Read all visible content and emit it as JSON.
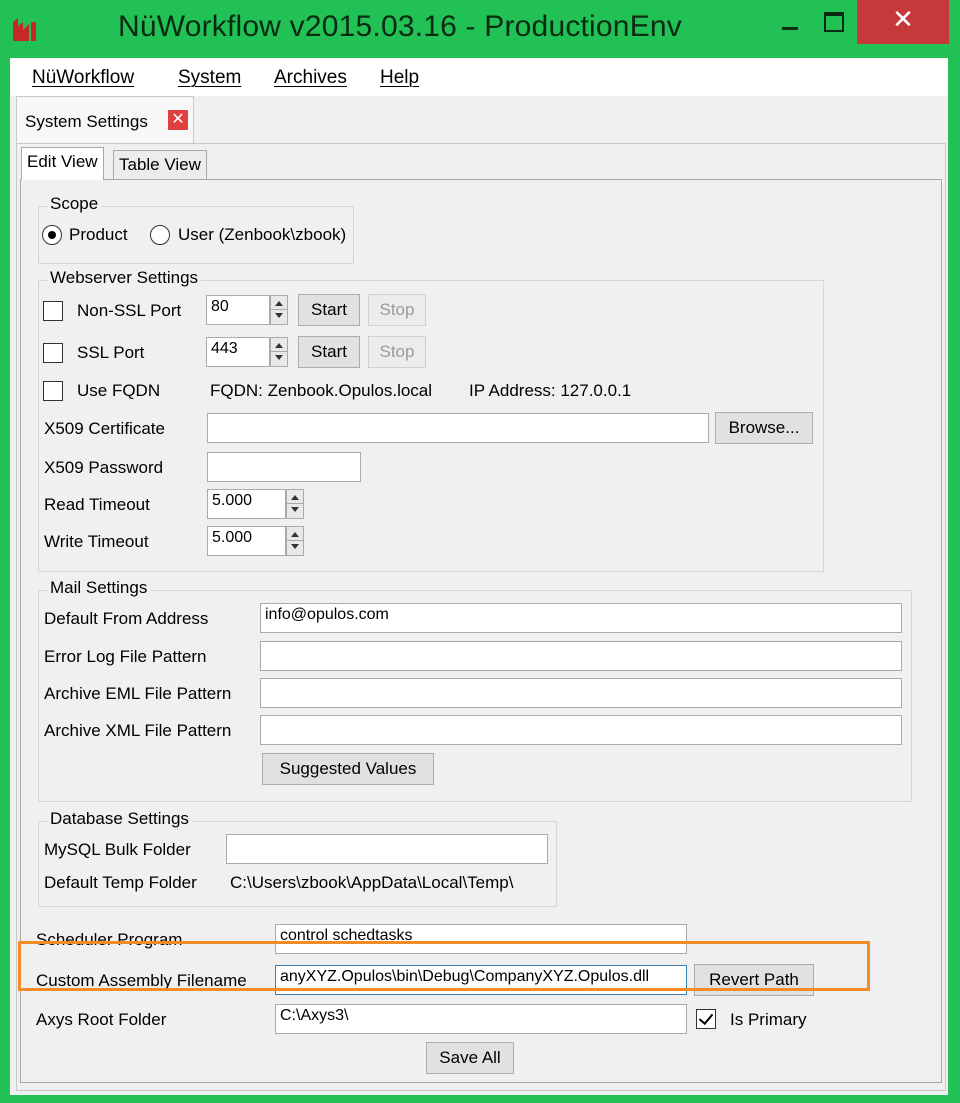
{
  "window": {
    "title": "NüWorkflow v2015.03.16 - ProductionEnv",
    "close_glyph": "✕"
  },
  "menu": [
    "NüWorkflow",
    "System",
    "Archives",
    "Help"
  ],
  "doc_tab": {
    "label": "System Settings",
    "close_glyph": "✕"
  },
  "view_tabs": [
    "Edit View",
    "Table View"
  ],
  "scope": {
    "title": "Scope",
    "options": [
      "Product",
      "User (Zenbook\\zbook)"
    ],
    "selected": "Product"
  },
  "webserver": {
    "title": "Webserver Settings",
    "non_ssl_label": "Non-SSL Port",
    "non_ssl_value": "80",
    "ssl_label": "SSL Port",
    "ssl_value": "443",
    "start_label": "Start",
    "stop_label": "Stop",
    "use_fqdn_label": "Use FQDN",
    "fqdn_text": "FQDN: Zenbook.Opulos.local",
    "ip_text": "IP Address: 127.0.0.1",
    "x509_cert_label": "X509 Certificate",
    "x509_cert_value": "",
    "browse_label": "Browse...",
    "x509_password_label": "X509 Password",
    "x509_password_value": "",
    "read_timeout_label": "Read Timeout",
    "read_timeout_value": "5.000",
    "write_timeout_label": "Write Timeout",
    "write_timeout_value": "5.000"
  },
  "mail": {
    "title": "Mail Settings",
    "default_from_label": "Default From Address",
    "default_from_value": "info@opulos.com",
    "error_log_label": "Error Log File Pattern",
    "error_log_value": "",
    "archive_eml_label": "Archive EML File Pattern",
    "archive_eml_value": "",
    "archive_xml_label": "Archive XML File Pattern",
    "archive_xml_value": "",
    "suggested_label": "Suggested Values"
  },
  "database": {
    "title": "Database Settings",
    "mysql_bulk_label": "MySQL Bulk Folder",
    "mysql_bulk_value": "",
    "temp_folder_label": "Default Temp Folder",
    "temp_folder_value": "C:\\Users\\zbook\\AppData\\Local\\Temp\\"
  },
  "bottom": {
    "scheduler_label": "Scheduler Program",
    "scheduler_value": "control schedtasks",
    "custom_assembly_label": "Custom Assembly Filename",
    "custom_assembly_value": "anyXYZ.Opulos\\bin\\Debug\\CompanyXYZ.Opulos.dll",
    "revert_label": "Revert Path",
    "axys_label": "Axys Root Folder",
    "axys_value": "C:\\Axys3\\",
    "is_primary_label": "Is Primary",
    "save_all_label": "Save All"
  },
  "colors": {
    "title_bar": "#21c155",
    "close_button": "#c7383a",
    "highlight": "#f28c28"
  }
}
